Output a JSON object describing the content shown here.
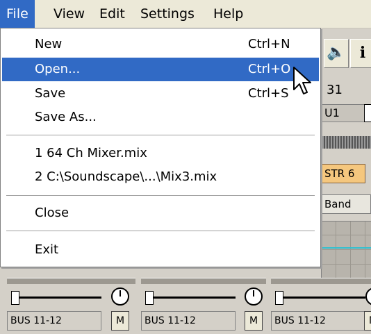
{
  "menubar": {
    "file": "File",
    "view": "View",
    "edit": "Edit",
    "settings": "Settings",
    "help": "Help"
  },
  "file_menu": {
    "new": {
      "label": "New",
      "shortcut": "Ctrl+N"
    },
    "open": {
      "label": "Open...",
      "shortcut": "Ctrl+O"
    },
    "save": {
      "label": "Save",
      "shortcut": "Ctrl+S"
    },
    "save_as": {
      "label": "Save As..."
    },
    "recent1": {
      "label": "1 64 Ch Mixer.mix"
    },
    "recent2": {
      "label": "2 C:\\Soundscape\\...\\Mix3.mix"
    },
    "close": {
      "label": "Close"
    },
    "exit": {
      "label": "Exit"
    }
  },
  "background": {
    "channel_num": "31",
    "strip_label": "U1",
    "str_label": "STR 6",
    "band_label": "Band",
    "strips": [
      {
        "bus": "BUS 11-12",
        "mute": "M"
      },
      {
        "bus": "BUS 11-12",
        "mute": "M"
      },
      {
        "bus": "BUS 11-12",
        "mute": "M"
      }
    ],
    "toolbar_icons": [
      "speaker-icon",
      "info-icon"
    ]
  },
  "colors": {
    "highlight": "#316ac5",
    "menubar": "#ece9d8",
    "str_tag": "#f5c77e"
  }
}
